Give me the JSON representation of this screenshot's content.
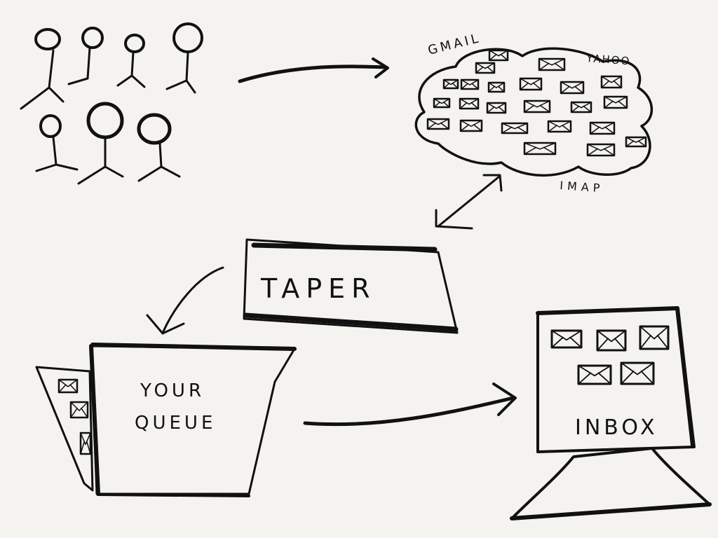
{
  "diagram": {
    "cloud": {
      "labels": {
        "gmail": "GMAIL",
        "yahoo": "YAHOO",
        "imap": "IMAP"
      }
    },
    "taper_label": "TAPER",
    "queue_label_line1": "YOUR",
    "queue_label_line2": "QUEUE",
    "inbox_label": "INBOX"
  }
}
